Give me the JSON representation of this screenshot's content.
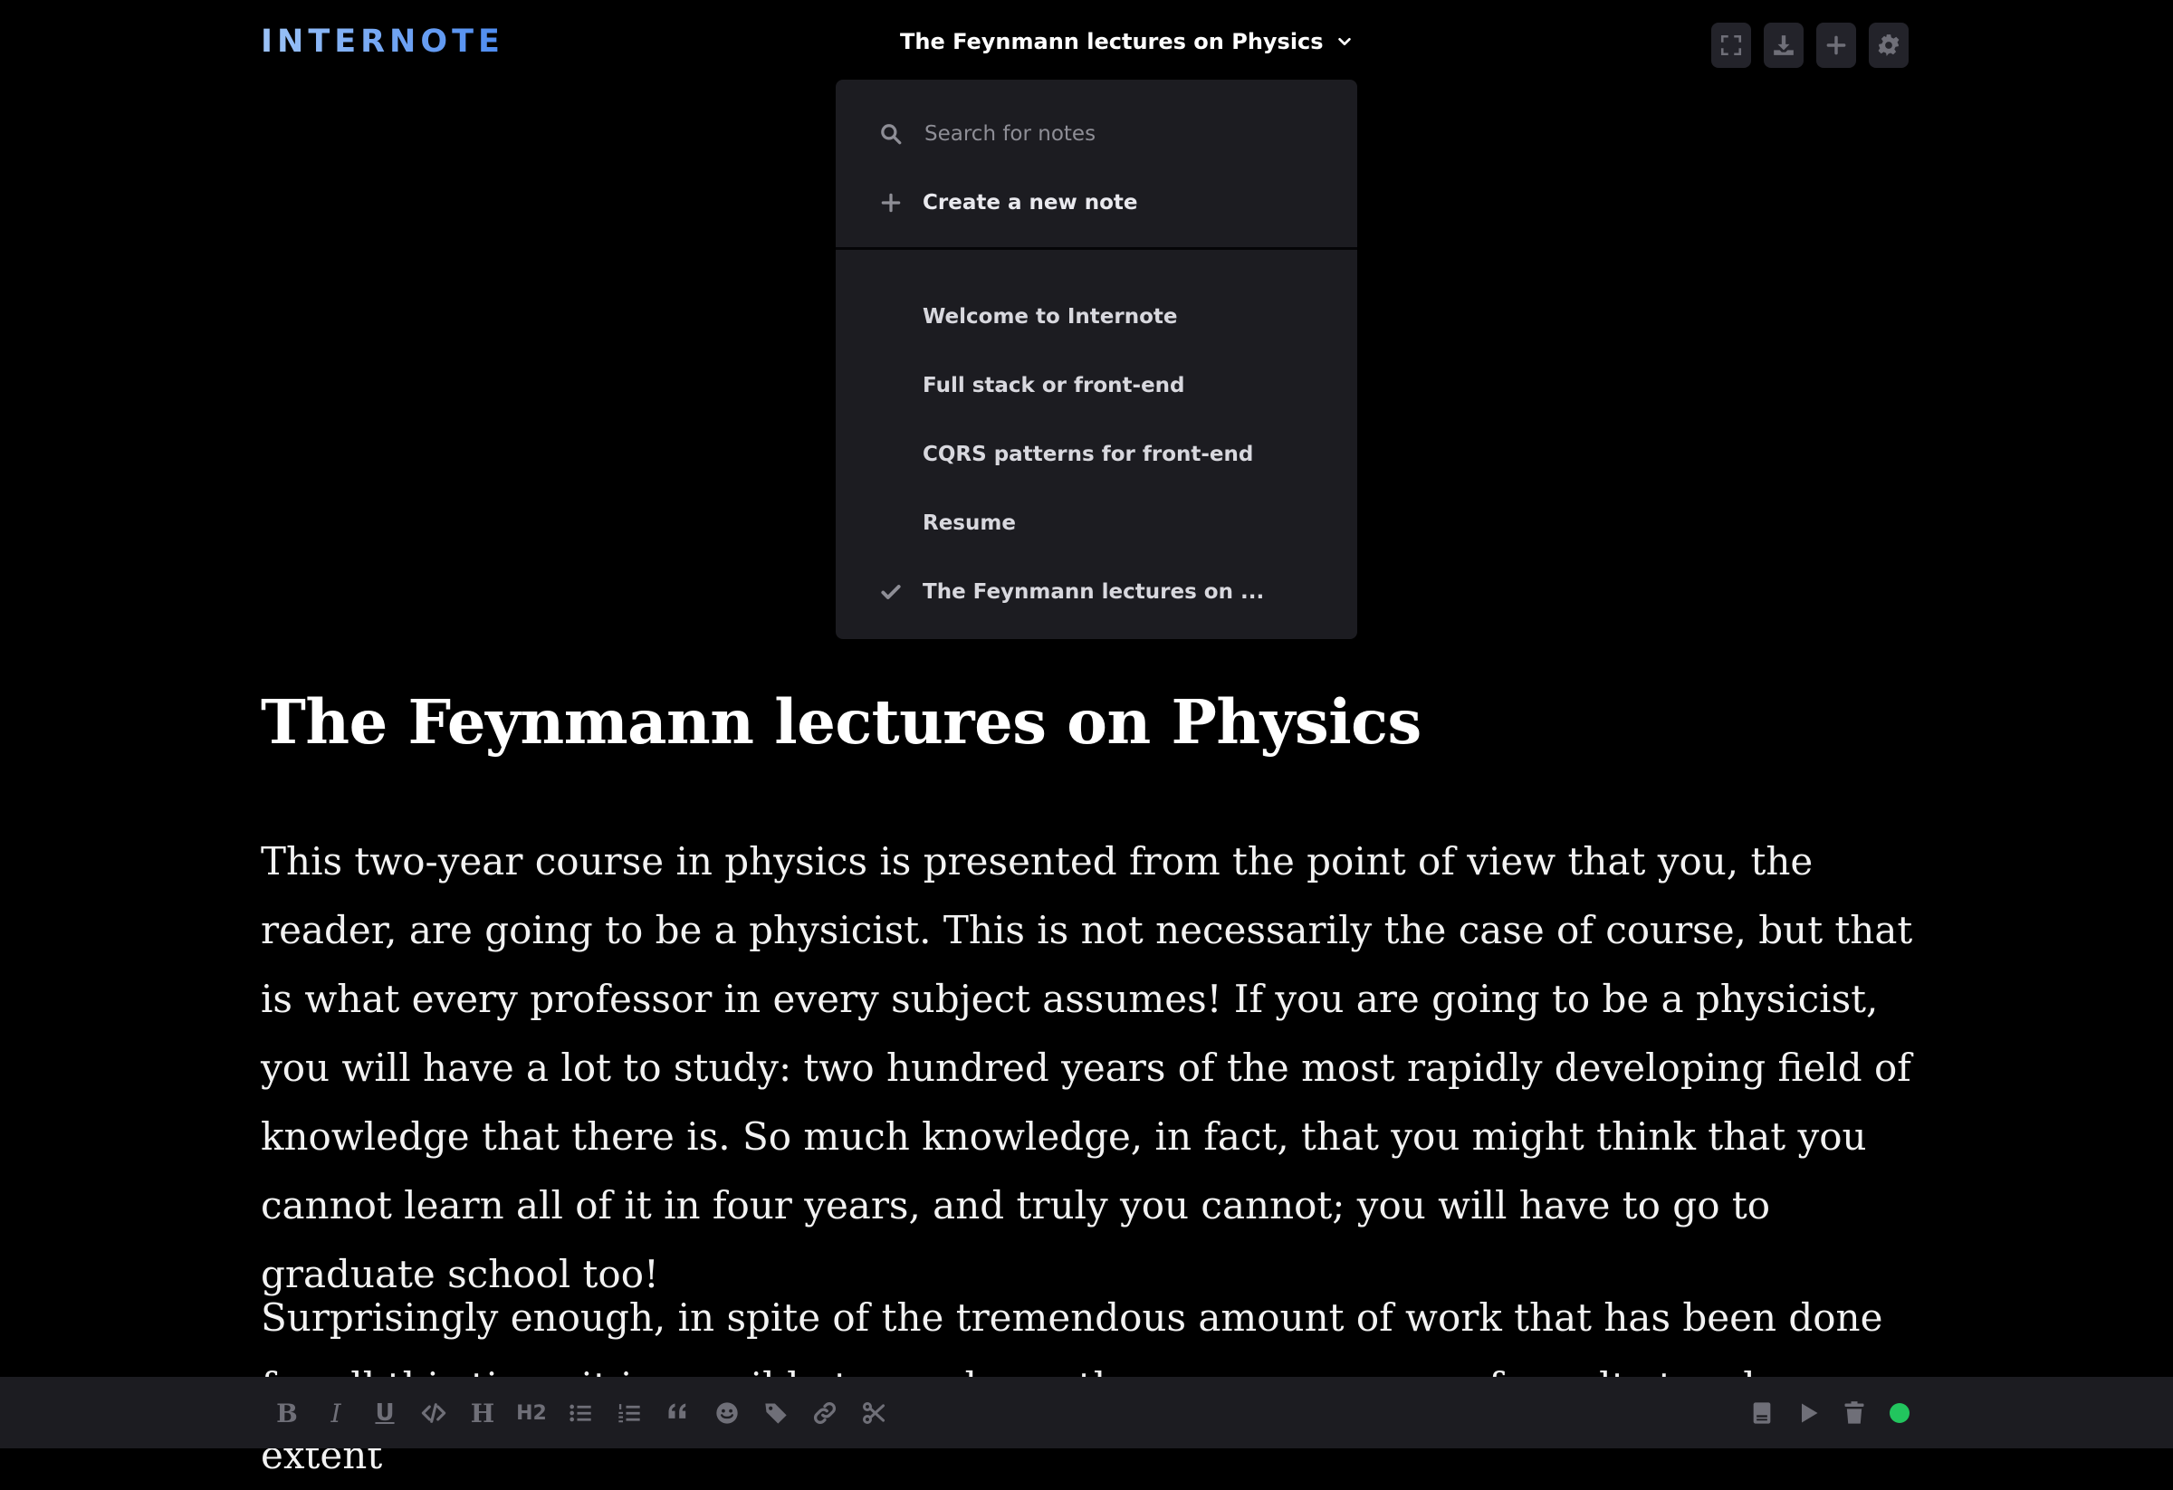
{
  "header": {
    "logo": "INTERNOTE",
    "current_note": "The Feynmann lectures on Physics",
    "actions": [
      {
        "icon": "fullscreen-icon"
      },
      {
        "icon": "download-icon"
      },
      {
        "icon": "plus-icon"
      },
      {
        "icon": "gear-icon"
      }
    ]
  },
  "dropdown": {
    "search_placeholder": "Search for notes",
    "create_label": "Create a new note",
    "notes": [
      {
        "label": "Welcome to Internote",
        "selected": false
      },
      {
        "label": "Full stack or front-end",
        "selected": false
      },
      {
        "label": "CQRS patterns for front-end",
        "selected": false
      },
      {
        "label": "Resume",
        "selected": false
      },
      {
        "label": "The Feynmann lectures on ...",
        "selected": true
      }
    ]
  },
  "document": {
    "title": "The Feynmann lectures on Physics",
    "paragraph1": "This two-year course in physics is presented from the point of view that you, the reader, are going to be a physicist. This is not necessarily the case of course, but that is what every professor in every subject assumes! If you are going to be a physicist, you will have a lot to study: two hundred years of the most rapidly developing field of knowledge that there is. So much knowledge, in fact, that you might think that you cannot learn all of it in four years, and truly you cannot; you will have to go to graduate school too!",
    "paragraph2": "Surprisingly enough, in spite of the tremendous amount of work that has been done for all this time, it is possible to condense the enormous mass of results to a large extent"
  },
  "toolbar": {
    "bold": "B",
    "italic": "I",
    "underline": "U",
    "heading1": "H",
    "heading2": "H2",
    "right_icons": [
      "notebook-icon",
      "play-icon",
      "trash-icon"
    ],
    "status_color": "#22c55e"
  },
  "colors": {
    "background": "#000000",
    "panel": "#1c1c21",
    "icon_muted": "#6f6f78",
    "accent_start": "#9cc3f7",
    "accent_end": "#4d8bf0"
  }
}
